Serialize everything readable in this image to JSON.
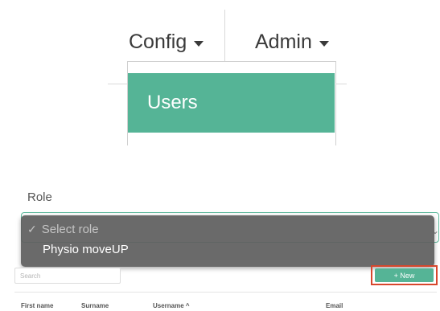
{
  "nav": {
    "config_label": "Config",
    "admin_label": "Admin",
    "menu": {
      "users_label": "Users"
    }
  },
  "role": {
    "label": "Role",
    "options": [
      {
        "label": "Select role",
        "selected": true
      },
      {
        "label": "Physio moveUP",
        "selected": false
      }
    ]
  },
  "users_table": {
    "search_placeholder": "Search",
    "new_button_label": "+ New",
    "columns": [
      "First name",
      "Surname",
      "Username ^",
      "Email"
    ]
  },
  "colors": {
    "accent": "#55b496",
    "highlight": "#d7472d",
    "dropdown_bg": "#5f5f5f"
  },
  "icons": [
    "chevron-down-icon",
    "checkmark-icon"
  ]
}
